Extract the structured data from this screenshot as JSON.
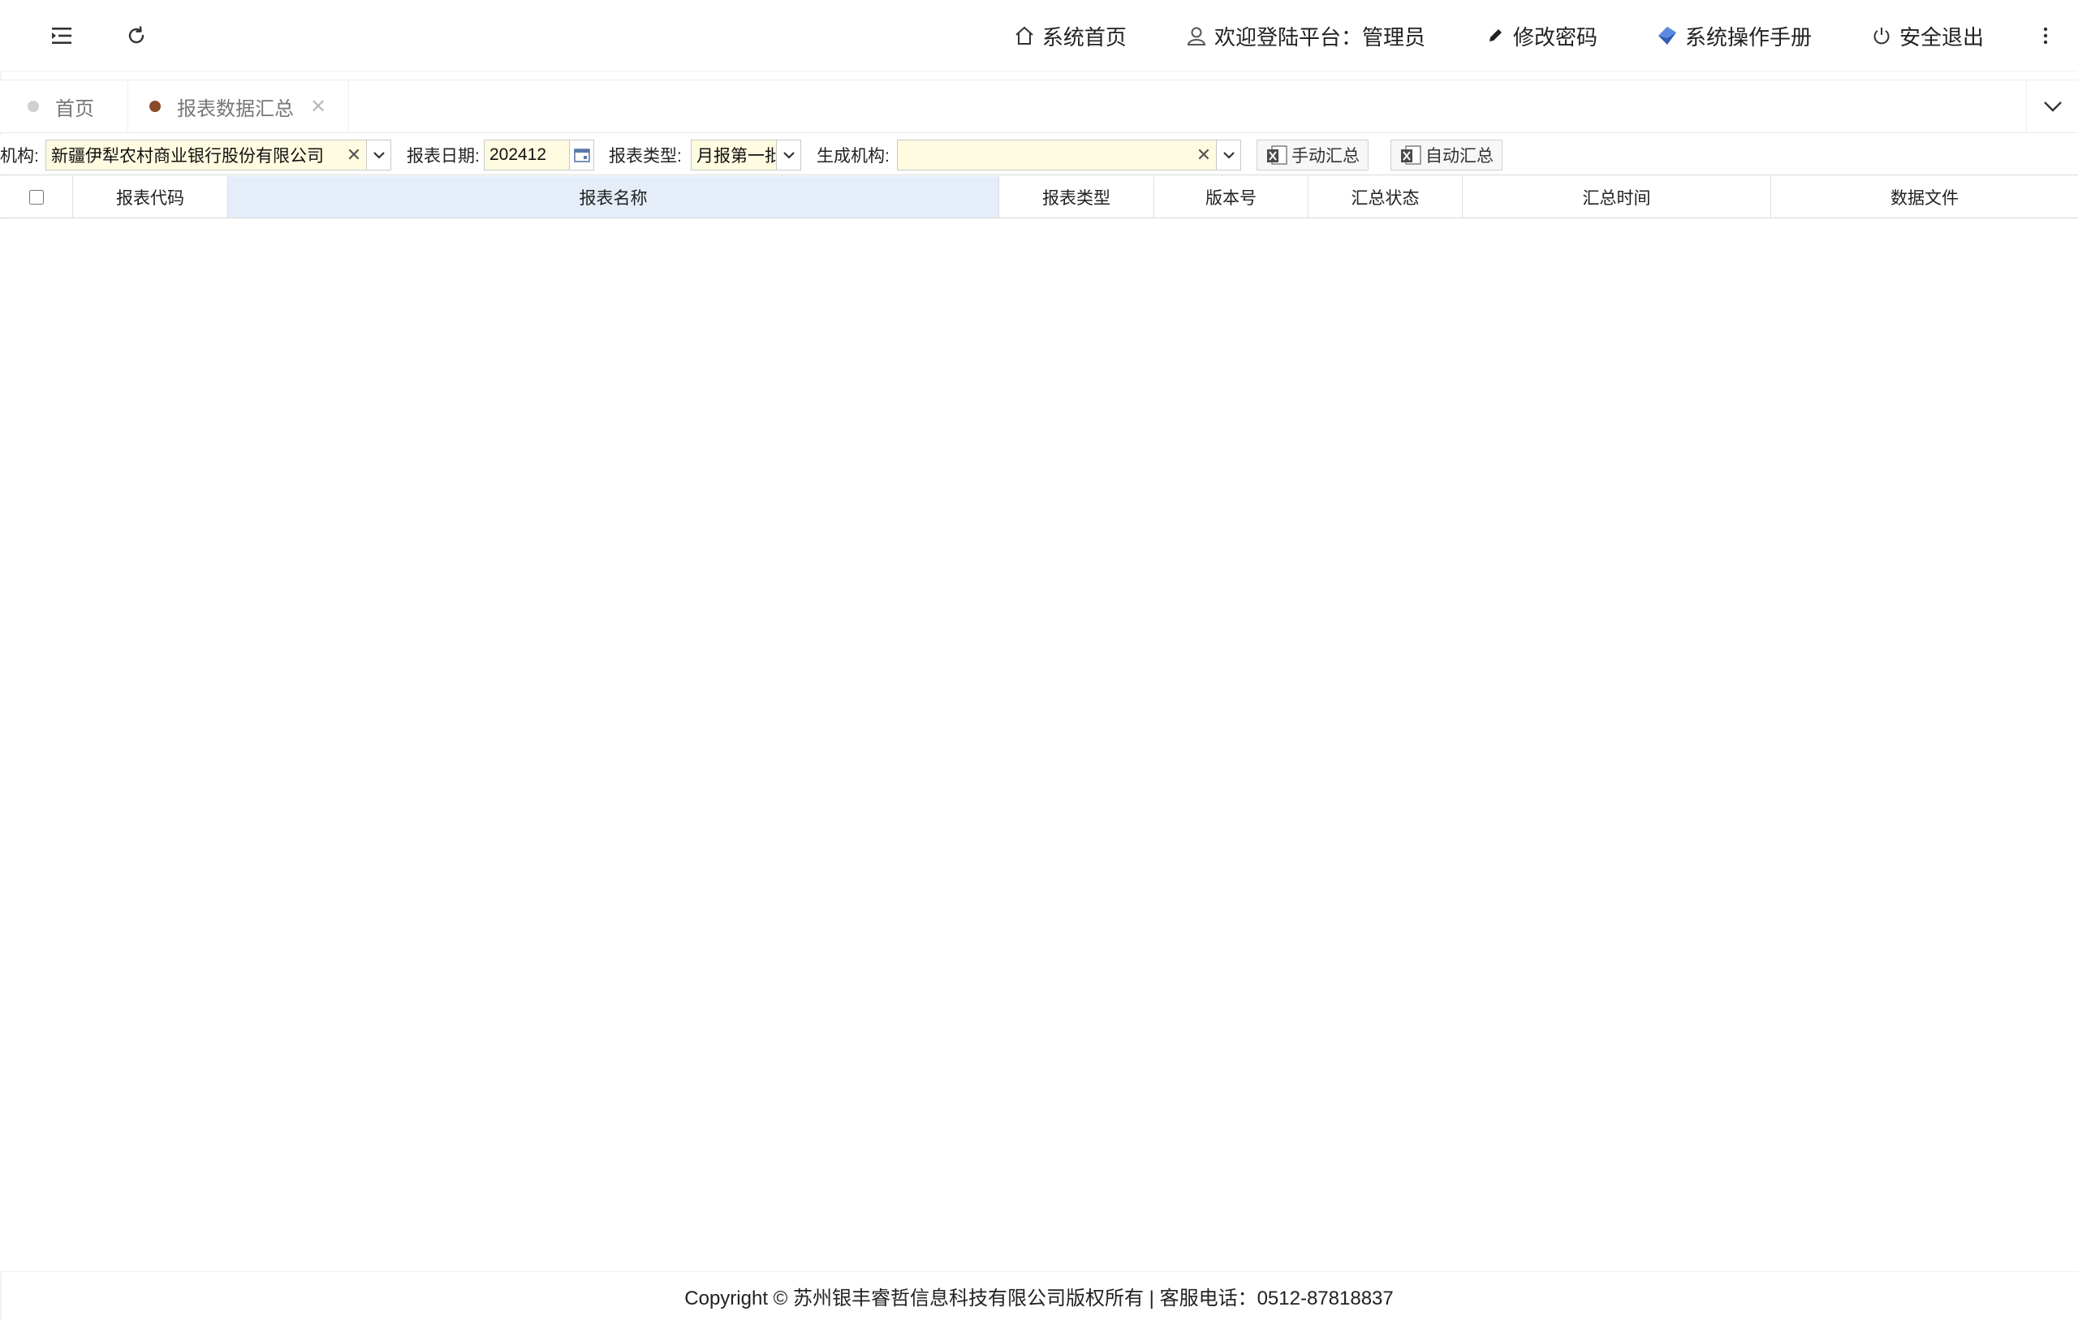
{
  "header": {
    "nav": {
      "home": "系统首页",
      "welcome": "欢迎登陆平台：管理员",
      "change_password": "修改密码",
      "manual": "系统操作手册",
      "logout": "安全退出"
    }
  },
  "tabs": [
    {
      "label": "首页",
      "dot_color": "#d0d0d0"
    },
    {
      "label": "报表数据汇总",
      "dot_color": "#8b4a2b"
    }
  ],
  "filters": {
    "org_label": "机构:",
    "org_value": "新疆伊犁农村商业银行股份有限公司",
    "date_label": "报表日期:",
    "date_value": "202412",
    "type_label": "报表类型:",
    "type_value": "月报第一批",
    "gen_org_label": "生成机构:",
    "gen_org_value": "",
    "manual_btn": "手动汇总",
    "auto_btn": "自动汇总"
  },
  "table": {
    "columns": [
      "报表代码",
      "报表名称",
      "报表类型",
      "版本号",
      "汇总状态",
      "汇总时间",
      "数据文件"
    ],
    "rows": []
  },
  "footer": {
    "text": "Copyright © 苏州银丰睿哲信息科技有限公司版权所有 | 客服电话：0512-87818837"
  },
  "colors": {
    "input_bg": "#fffbe0",
    "active_col_bg": "#e5eef8",
    "manual_icon": "#3a6fc9"
  }
}
